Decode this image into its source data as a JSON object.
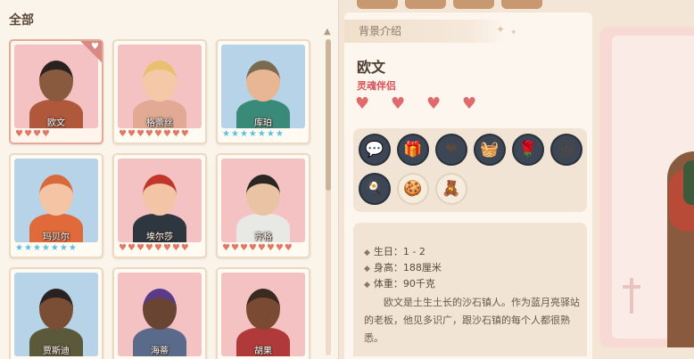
{
  "left": {
    "title": "全部",
    "characters": [
      {
        "name": "欧文",
        "bg": "pink",
        "hearts": 4,
        "heart_type": "heart",
        "selected": true,
        "favorite": true
      },
      {
        "name": "格蕾丝",
        "bg": "pink",
        "hearts": 8,
        "heart_type": "heart"
      },
      {
        "name": "库珀",
        "bg": "blue",
        "hearts": 7,
        "heart_type": "star"
      },
      {
        "name": "玛贝尔",
        "bg": "blue",
        "hearts": 7,
        "heart_type": "star"
      },
      {
        "name": "埃尔莎",
        "bg": "pink",
        "hearts": 8,
        "heart_type": "heart"
      },
      {
        "name": "齐格",
        "bg": "pink",
        "hearts": 8,
        "heart_type": "heart"
      },
      {
        "name": "贾斯迪",
        "bg": "blue",
        "hearts": 0,
        "heart_type": "heart"
      },
      {
        "name": "海蒂",
        "bg": "pink",
        "hearts": 0,
        "heart_type": "heart"
      },
      {
        "name": "胡果",
        "bg": "pink",
        "hearts": 0,
        "heart_type": "heart"
      }
    ]
  },
  "detail": {
    "section_title": "背景介绍",
    "name": "欧文",
    "relation": "灵魂伴侣",
    "relation_hearts": 4,
    "gifts": [
      {
        "icon": "chat-bubble-icon",
        "glyph": "💬",
        "style": "dark"
      },
      {
        "icon": "gift-box-icon",
        "glyph": "🎁",
        "style": "dark"
      },
      {
        "icon": "heart-icon",
        "glyph": "❤",
        "style": "dark"
      },
      {
        "icon": "washing-machine-icon",
        "glyph": "🧺",
        "style": "dark"
      },
      {
        "icon": "rose-icon",
        "glyph": "🌹",
        "style": "dark"
      },
      {
        "icon": "photo-icon",
        "glyph": "🖼",
        "style": "dark"
      },
      {
        "icon": "chef-hat-icon",
        "glyph": "🍳",
        "style": "dark"
      },
      {
        "icon": "gingerbread-icon",
        "glyph": "🍪",
        "style": "tan"
      },
      {
        "icon": "teddy-bear-icon",
        "glyph": "🧸",
        "style": "tan"
      }
    ],
    "birthday_label": "生日：",
    "birthday": "1 - 2",
    "height_label": "身高：",
    "height": "188厘米",
    "weight_label": "体重：",
    "weight": "90千克",
    "bio": "欧文是土生土长的沙石镇人。作为蓝月亮驿站的老板，他见多识广，跟沙石镇的每个人都很熟悉。"
  },
  "colors": {
    "heart": "#e07864",
    "star": "#5cc0e0",
    "relation": "#d8505a"
  }
}
